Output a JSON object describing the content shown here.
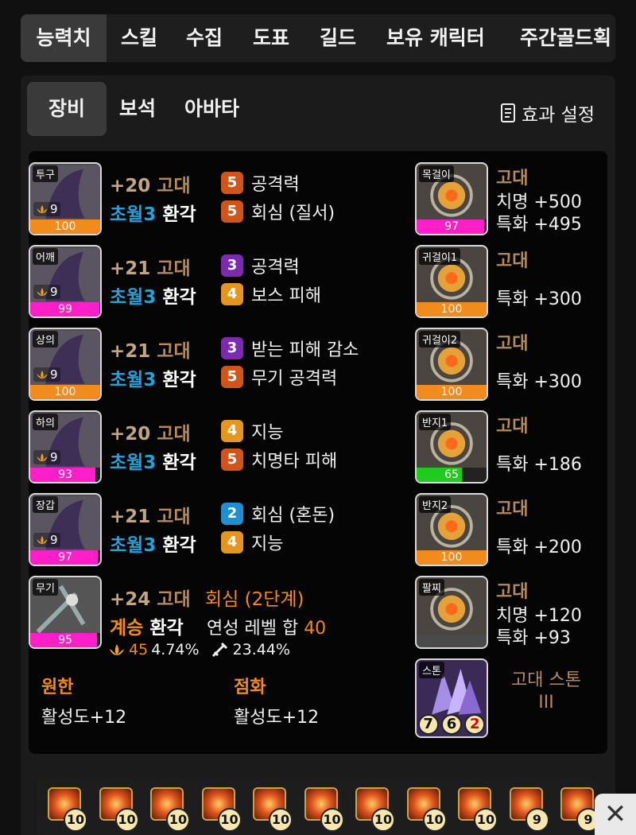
{
  "tabs": [
    "능력치",
    "스킬",
    "수집",
    "도표",
    "길드",
    "보유 캐릭터",
    "주간골드획"
  ],
  "subtabs": [
    "장비",
    "보석",
    "아바타"
  ],
  "effect_setting": "효과 설정",
  "equipment": [
    {
      "slot": "투구",
      "level": "9",
      "quality": 100,
      "quality_color": "#f08b1c",
      "refine": "+20",
      "tier": "고대",
      "transc": "초월3",
      "adv": "환각",
      "opt1_grade": "5",
      "opt1": "공격력",
      "opt2_grade": "5",
      "opt2": "회심 (질서)"
    },
    {
      "slot": "어깨",
      "level": "9",
      "quality": 99,
      "quality_color": "#ff1fc8",
      "refine": "+21",
      "tier": "고대",
      "transc": "초월3",
      "adv": "환각",
      "opt1_grade": "3",
      "opt1": "공격력",
      "opt2_grade": "4",
      "opt2": "보스 피해"
    },
    {
      "slot": "상의",
      "level": "9",
      "quality": 100,
      "quality_color": "#f08b1c",
      "refine": "+21",
      "tier": "고대",
      "transc": "초월3",
      "adv": "환각",
      "opt1_grade": "3",
      "opt1": "받는 피해 감소",
      "opt2_grade": "5",
      "opt2": "무기 공격력"
    },
    {
      "slot": "하의",
      "level": "9",
      "quality": 93,
      "quality_color": "#ff1fc8",
      "refine": "+20",
      "tier": "고대",
      "transc": "초월3",
      "adv": "환각",
      "opt1_grade": "4",
      "opt1": "지능",
      "opt2_grade": "5",
      "opt2": "치명타 피해"
    },
    {
      "slot": "장갑",
      "level": "9",
      "quality": 97,
      "quality_color": "#ff1fc8",
      "refine": "+21",
      "tier": "고대",
      "transc": "초월3",
      "adv": "환각",
      "opt1_grade": "2",
      "opt1": "회심 (혼돈)",
      "opt2_grade": "4",
      "opt2": "지능"
    }
  ],
  "weapon": {
    "slot": "무기",
    "quality": 95,
    "quality_color": "#ff1fc8",
    "refine": "+24",
    "tier": "고대",
    "elixir": "회심 (2단계)",
    "succession": "계승",
    "adv": "환각",
    "elixir_label": "연성 레벨 합",
    "elixir_sum": "40",
    "stat1": "45",
    "stat1_pct": "4.74%",
    "stat2_pct": "23.44%"
  },
  "engravings": {
    "left_title": "원한",
    "left_value": "활성도+12",
    "right_title": "점화",
    "right_value": "활성도+12"
  },
  "accessories": [
    {
      "slot": "목걸이",
      "quality": 97,
      "quality_color": "#ff1fc8",
      "tier": "고대",
      "stats": [
        "치명 +500",
        "특화 +495"
      ]
    },
    {
      "slot": "귀걸이1",
      "quality": 100,
      "quality_color": "#f08b1c",
      "tier": "고대",
      "stats": [
        "특화 +300"
      ]
    },
    {
      "slot": "귀걸이2",
      "quality": 100,
      "quality_color": "#f08b1c",
      "tier": "고대",
      "stats": [
        "특화 +300"
      ]
    },
    {
      "slot": "반지1",
      "quality": 65,
      "quality_color": "#1ecb1e",
      "tier": "고대",
      "stats": [
        "특화 +186"
      ]
    },
    {
      "slot": "반지2",
      "quality": 100,
      "quality_color": "#f08b1c",
      "tier": "고대",
      "stats": [
        "특화 +200"
      ]
    },
    {
      "slot": "팔찌",
      "quality": null,
      "quality_color": "",
      "tier": "고대",
      "stats": [
        "치명 +120",
        "특화 +93"
      ]
    }
  ],
  "stone": {
    "slot": "스톤",
    "name_line1": "고대 스톤",
    "name_line2": "III",
    "vals": [
      "7",
      "6",
      "2"
    ]
  },
  "gems": [
    "10",
    "10",
    "10",
    "10",
    "10",
    "10",
    "10",
    "10",
    "10",
    "9",
    "9"
  ],
  "close": "✕"
}
